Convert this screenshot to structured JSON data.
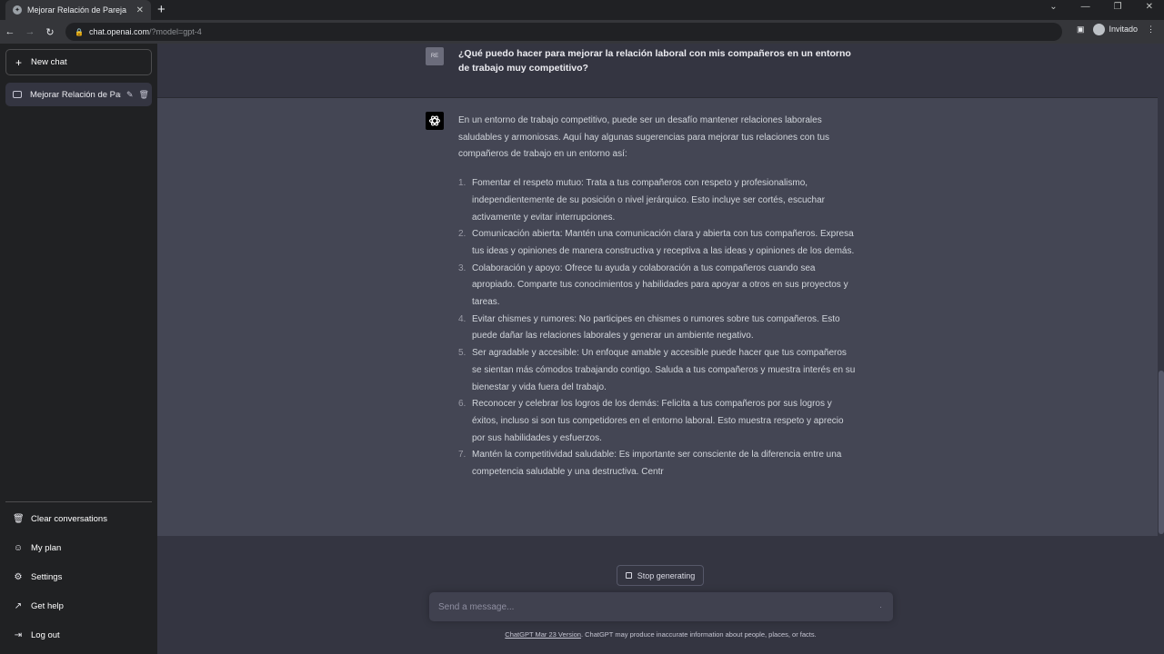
{
  "browser": {
    "tab_title": "Mejorar Relación de Pareja",
    "url_host": "chat.openai.com",
    "url_path": "/?model=gpt-4",
    "profile_label": "Invitado"
  },
  "sidebar": {
    "new_chat_label": "New chat",
    "conversation_title": "Mejorar Relación de Pareja",
    "menu": [
      {
        "label": "Clear conversations",
        "icon": "trash-icon"
      },
      {
        "label": "My plan",
        "icon": "user-icon"
      },
      {
        "label": "Settings",
        "icon": "gear-icon"
      },
      {
        "label": "Get help",
        "icon": "external-link-icon"
      },
      {
        "label": "Log out",
        "icon": "logout-icon"
      }
    ]
  },
  "conversation": {
    "user_avatar_initials": "RE",
    "user_message": "¿Qué puedo hacer para mejorar la relación laboral con mis compañeros en un entorno de trabajo muy competitivo?",
    "assistant_intro": "En un entorno de trabajo competitivo, puede ser un desafío mantener relaciones laborales saludables y armoniosas. Aquí hay algunas sugerencias para mejorar tus relaciones con tus compañeros de trabajo en un entorno así:",
    "items": [
      {
        "num": "1.",
        "text": "Fomentar el respeto mutuo: Trata a tus compañeros con respeto y profesionalismo, independientemente de su posición o nivel jerárquico. Esto incluye ser cortés, escuchar activamente y evitar interrupciones."
      },
      {
        "num": "2.",
        "text": "Comunicación abierta: Mantén una comunicación clara y abierta con tus compañeros. Expresa tus ideas y opiniones de manera constructiva y receptiva a las ideas y opiniones de los demás."
      },
      {
        "num": "3.",
        "text": "Colaboración y apoyo: Ofrece tu ayuda y colaboración a tus compañeros cuando sea apropiado. Comparte tus conocimientos y habilidades para apoyar a otros en sus proyectos y tareas."
      },
      {
        "num": "4.",
        "text": "Evitar chismes y rumores: No participes en chismes o rumores sobre tus compañeros. Esto puede dañar las relaciones laborales y generar un ambiente negativo."
      },
      {
        "num": "5.",
        "text": "Ser agradable y accesible: Un enfoque amable y accesible puede hacer que tus compañeros se sientan más cómodos trabajando contigo. Saluda a tus compañeros y muestra interés en su bienestar y vida fuera del trabajo."
      },
      {
        "num": "6.",
        "text": "Reconocer y celebrar los logros de los demás: Felicita a tus compañeros por sus logros y éxitos, incluso si son tus competidores en el entorno laboral. Esto muestra respeto y aprecio por sus habilidades y esfuerzos."
      },
      {
        "num": "7.",
        "text": "Mantén la competitividad saludable: Es importante ser consciente de la diferencia entre una competencia saludable y una destructiva. Centr"
      }
    ]
  },
  "composer": {
    "stop_label": "Stop generating",
    "placeholder": "Send a message...",
    "footer_link": "ChatGPT Mar 23 Version",
    "footer_text": ". ChatGPT may produce inaccurate information about people, places, or facts."
  }
}
